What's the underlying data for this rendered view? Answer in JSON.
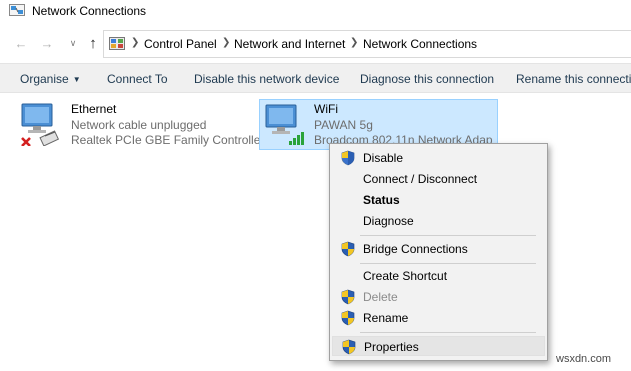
{
  "window": {
    "title": "Network Connections"
  },
  "navigation": {
    "back_icon": "arrow-left-icon",
    "forward_icon": "arrow-right-icon",
    "recent_icon": "chevron-down-icon",
    "up_icon": "arrow-up-icon",
    "breadcrumb": [
      "Control Panel",
      "Network and Internet",
      "Network Connections"
    ]
  },
  "command_bar": {
    "organise": "Organise",
    "items": [
      "Connect To",
      "Disable this network device",
      "Diagnose this connection",
      "Rename this connectio"
    ]
  },
  "adapters": [
    {
      "name": "Ethernet",
      "status": "Network cable unplugged",
      "device": "Realtek PCIe GBE Family Controller",
      "selected": false,
      "icon": "ethernet-adapter-disconnected-icon"
    },
    {
      "name": "WiFi",
      "status": "PAWAN 5g",
      "device": "Broadcom 802.11n Network Adap",
      "selected": true,
      "icon": "wifi-adapter-connected-icon"
    }
  ],
  "context_menu": {
    "items": [
      {
        "label": "Disable",
        "shield": true,
        "bold": false,
        "disabled": false
      },
      {
        "label": "Connect / Disconnect",
        "shield": false,
        "bold": false,
        "disabled": false
      },
      {
        "label": "Status",
        "shield": false,
        "bold": true,
        "disabled": false
      },
      {
        "label": "Diagnose",
        "shield": false,
        "bold": false,
        "disabled": false
      },
      {
        "label": "Bridge Connections",
        "shield": true,
        "bold": false,
        "disabled": false
      },
      {
        "label": "Create Shortcut",
        "shield": false,
        "bold": false,
        "disabled": false
      },
      {
        "label": "Delete",
        "shield": true,
        "bold": false,
        "disabled": true
      },
      {
        "label": "Rename",
        "shield": true,
        "bold": false,
        "disabled": false
      },
      {
        "label": "Properties",
        "shield": true,
        "bold": false,
        "disabled": false,
        "highlighted": true
      }
    ]
  },
  "watermark": "wsxdn.com",
  "colors": {
    "selection_bg": "#cce8ff",
    "selection_border": "#99d1ff",
    "command_text": "#1e3950",
    "secondary_text": "#6d6d6d",
    "menu_bg": "#f2f2f2"
  }
}
